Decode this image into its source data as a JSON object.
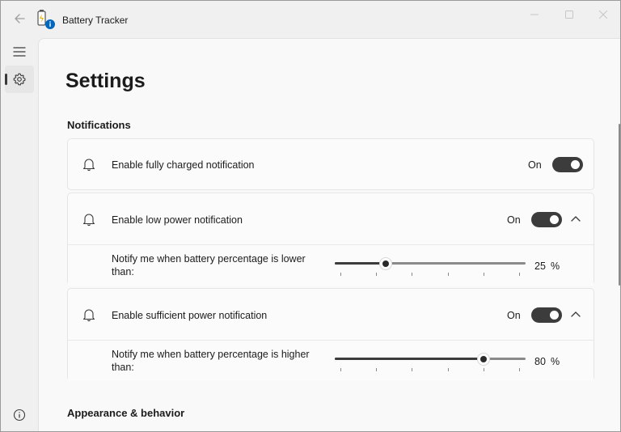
{
  "window": {
    "title": "Battery Tracker",
    "icons": {
      "back": "back-arrow-icon",
      "app": "battery-info-icon",
      "minimize": "minimize-icon",
      "maximize": "maximize-icon",
      "close": "close-icon"
    }
  },
  "sidebar": {
    "items": [
      {
        "name": "menu",
        "icon": "hamburger-menu-icon",
        "selected": false
      },
      {
        "name": "settings",
        "icon": "gear-icon",
        "selected": true
      }
    ],
    "footer_icon": "info-icon"
  },
  "page": {
    "title": "Settings",
    "sections": [
      {
        "title": "Notifications",
        "cards": [
          {
            "label": "Enable fully charged notification",
            "state": "On",
            "toggle_on": true,
            "expandable": false,
            "icon": "bell-icon"
          },
          {
            "label": "Enable low power notification",
            "state": "On",
            "toggle_on": true,
            "expandable": true,
            "expanded": true,
            "icon": "bell-icon",
            "sub": {
              "label": "Notify me when battery percentage is lower than:",
              "value": 25,
              "value_text": "25",
              "unit": "%"
            }
          },
          {
            "label": "Enable sufficient power notification",
            "state": "On",
            "toggle_on": true,
            "expandable": true,
            "expanded": true,
            "icon": "bell-icon",
            "sub": {
              "label": "Notify me when battery percentage is higher than:",
              "value": 80,
              "value_text": "80",
              "unit": "%"
            }
          }
        ]
      },
      {
        "title": "Appearance & behavior",
        "cards": []
      }
    ]
  },
  "colors": {
    "toggle_on": "#3c3c3c",
    "content_bg": "#f9f9f9",
    "chrome_bg": "#f0f0f0",
    "accent_badge": "#0067c0"
  }
}
